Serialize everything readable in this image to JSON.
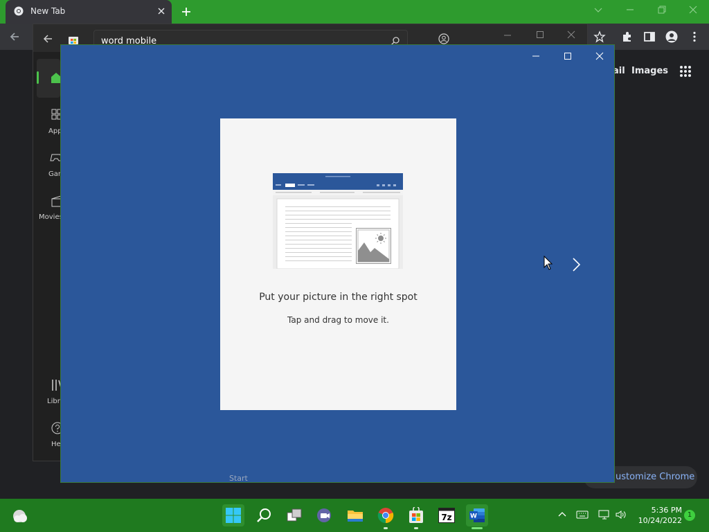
{
  "chrome": {
    "tab_title": "New Tab",
    "links": {
      "gmail": "ail",
      "images": "Images"
    },
    "customize_label": "ustomize Chrome"
  },
  "store": {
    "search_value": "word mobile",
    "nav": {
      "apps": "App",
      "gaming": "Gam",
      "movies": "Movies",
      "library": "Libra",
      "help": "He"
    }
  },
  "word": {
    "card_title": "Put your picture in the right spot",
    "card_subtitle": "Tap and drag to move it.",
    "start_label": "Start"
  },
  "taskbar": {
    "time": "5:36 PM",
    "date": "10/24/2022",
    "notification_count": "1"
  },
  "colors": {
    "word_blue": "#2b579a",
    "taskbar_green": "#1f7a1f",
    "tab_strip_green": "#2e9b2e"
  },
  "icons": [
    "chrome-logo-icon",
    "close-icon",
    "plus-icon",
    "back-arrow-icon",
    "store-icon",
    "search-icon",
    "account-icon",
    "star-icon",
    "extensions-icon",
    "sidepanel-icon",
    "profile-icon",
    "more-icon",
    "apps-grid-icon",
    "home-icon",
    "apps-icon",
    "gaming-icon",
    "movies-icon",
    "library-icon",
    "help-icon",
    "minimize-icon",
    "maximize-icon",
    "chevron-right-icon",
    "cursor-icon",
    "weather-icon",
    "start-icon",
    "search-taskbar-icon",
    "task-view-icon",
    "teams-icon",
    "file-explorer-icon",
    "chrome-taskbar-icon",
    "store-taskbar-icon",
    "7zip-icon",
    "word-icon",
    "chevron-up-icon",
    "keyboard-icon",
    "network-icon",
    "volume-icon"
  ]
}
